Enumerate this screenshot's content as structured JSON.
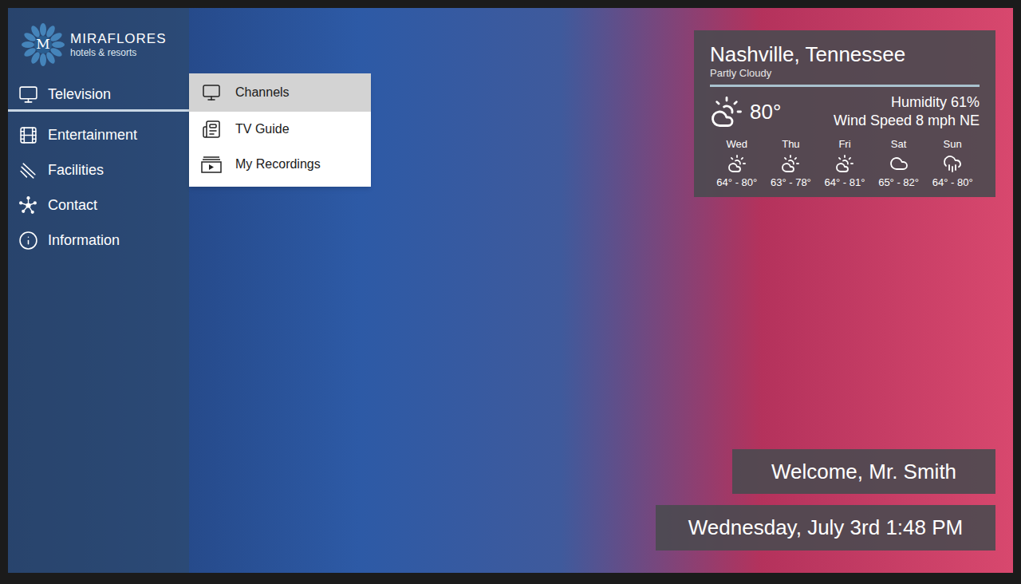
{
  "brand": {
    "monogram": "M",
    "name": "MIRAFLORES",
    "tagline": "hotels & resorts"
  },
  "sidebar": {
    "items": [
      {
        "label": "Television",
        "selected": true
      },
      {
        "label": "Entertainment",
        "selected": false
      },
      {
        "label": "Facilities",
        "selected": false
      },
      {
        "label": "Contact",
        "selected": false
      },
      {
        "label": "Information",
        "selected": false
      }
    ]
  },
  "submenu": {
    "items": [
      {
        "label": "Channels",
        "selected": true
      },
      {
        "label": "TV Guide",
        "selected": false
      },
      {
        "label": "My Recordings",
        "selected": false
      }
    ]
  },
  "weather": {
    "city": "Nashville, Tennessee",
    "condition": "Partly Cloudy",
    "kind": "partly-cloudy",
    "temperature": "80°",
    "humidity": "Humidity 61%",
    "wind": "Wind Speed 8 mph NE",
    "forecast": [
      {
        "day": "Wed",
        "kind": "partly-cloudy",
        "range": "64° - 80°"
      },
      {
        "day": "Thu",
        "kind": "partly-cloudy",
        "range": "63° - 78°"
      },
      {
        "day": "Fri",
        "kind": "partly-cloudy",
        "range": "64° - 81°"
      },
      {
        "day": "Sat",
        "kind": "cloudy",
        "range": "65° - 82°"
      },
      {
        "day": "Sun",
        "kind": "rain",
        "range": "64° - 80°"
      }
    ]
  },
  "welcome": "Welcome, Mr. Smith",
  "datetime": "Wednesday, July 3rd 1:48 PM"
}
